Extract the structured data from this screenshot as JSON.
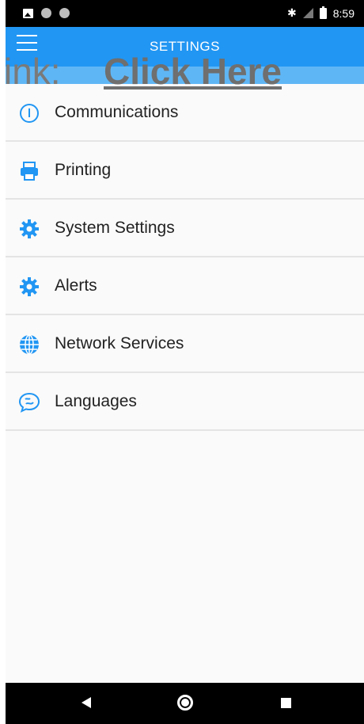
{
  "status_bar": {
    "time": "8:59",
    "icons": [
      "image-icon",
      "circle-icon",
      "circle-icon",
      "bluetooth-icon",
      "no-signal-icon",
      "battery-icon"
    ]
  },
  "app_bar": {
    "title": "SETTINGS",
    "menu_icon": "hamburger-menu-icon"
  },
  "overlay": {
    "prefix": "ink:",
    "link_text": "Click Here"
  },
  "settings": {
    "items": [
      {
        "label": "Communications",
        "icon": "info-icon"
      },
      {
        "label": "Printing",
        "icon": "printer-icon"
      },
      {
        "label": "System Settings",
        "icon": "gear-icon"
      },
      {
        "label": "Alerts",
        "icon": "gear-icon"
      },
      {
        "label": "Network Services",
        "icon": "globe-icon"
      },
      {
        "label": "Languages",
        "icon": "chat-bubble-icon"
      }
    ]
  },
  "nav_bar": {
    "icons": [
      "back-icon",
      "home-icon",
      "recent-apps-icon"
    ]
  },
  "colors": {
    "accent": "#2196f3",
    "app_bar_light": "#5fb6f5",
    "background": "#fafafa",
    "divider": "#e4e4e4"
  }
}
